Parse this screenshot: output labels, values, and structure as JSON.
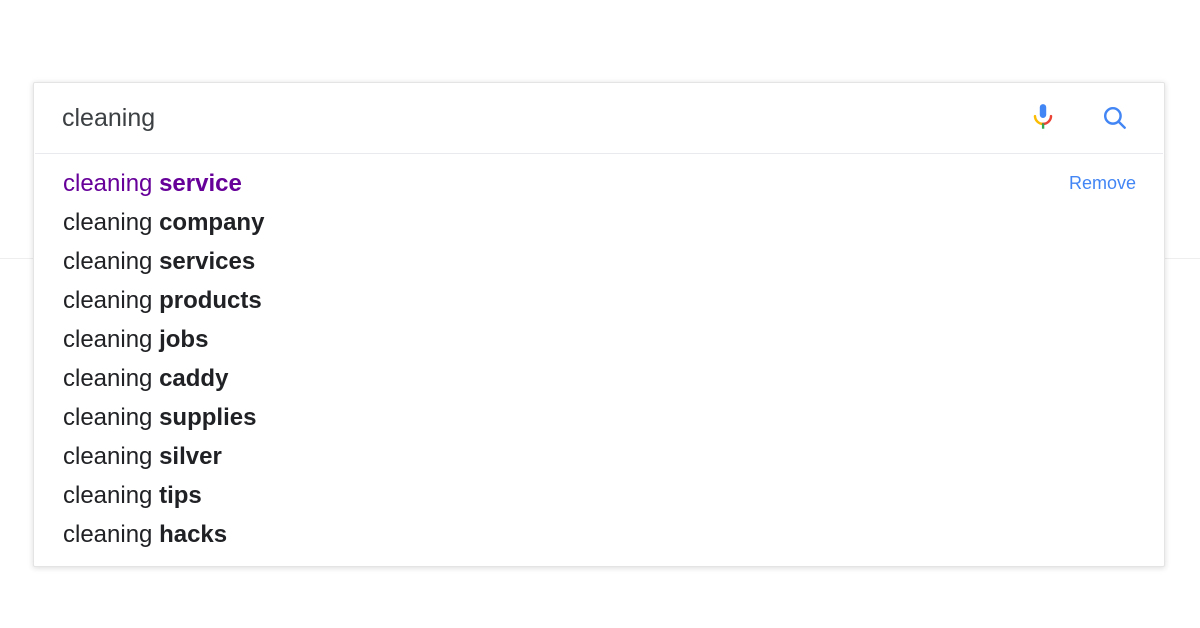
{
  "colors": {
    "accent_blue": "#4285f4",
    "visited_purple": "#660099",
    "text_dark": "#202124",
    "input_text": "#3c4043",
    "border": "#e4e4e4",
    "divider": "#e8eaed",
    "mic_blue": "#4285f4",
    "mic_red": "#ea4335",
    "mic_yellow": "#fbbc05",
    "mic_green": "#34a853",
    "page_rule": "#eeeeee",
    "background": "#ffffff"
  },
  "search": {
    "value": "cleaning",
    "placeholder": "Search",
    "mic_icon": "microphone-icon",
    "search_icon": "search-icon"
  },
  "suggestions": {
    "remove_label": "Remove",
    "items": [
      {
        "prefix": "cleaning ",
        "match": "service",
        "visited": true,
        "has_remove": true
      },
      {
        "prefix": "cleaning ",
        "match": "company",
        "visited": false,
        "has_remove": false
      },
      {
        "prefix": "cleaning ",
        "match": "services",
        "visited": false,
        "has_remove": false
      },
      {
        "prefix": "cleaning ",
        "match": "products",
        "visited": false,
        "has_remove": false
      },
      {
        "prefix": "cleaning ",
        "match": "jobs",
        "visited": false,
        "has_remove": false
      },
      {
        "prefix": "cleaning ",
        "match": "caddy",
        "visited": false,
        "has_remove": false
      },
      {
        "prefix": "cleaning ",
        "match": "supplies",
        "visited": false,
        "has_remove": false
      },
      {
        "prefix": "cleaning ",
        "match": "silver",
        "visited": false,
        "has_remove": false
      },
      {
        "prefix": "cleaning ",
        "match": "tips",
        "visited": false,
        "has_remove": false
      },
      {
        "prefix": "cleaning ",
        "match": "hacks",
        "visited": false,
        "has_remove": false
      }
    ]
  }
}
